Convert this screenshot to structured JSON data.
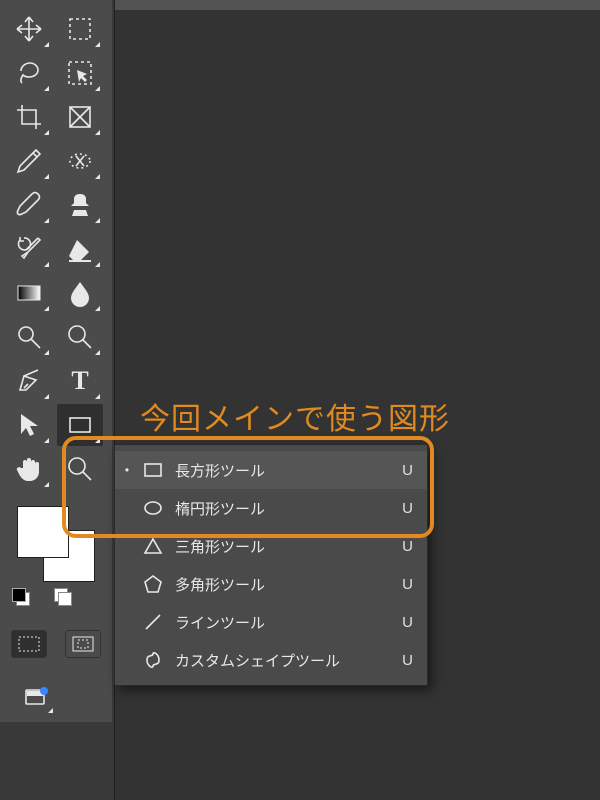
{
  "annotation": {
    "title": "今回メインで使う図形"
  },
  "flyout": {
    "items": [
      {
        "label": "長方形ツール",
        "shortcut": "U",
        "active": true
      },
      {
        "label": "楕円形ツール",
        "shortcut": "U",
        "active": false
      },
      {
        "label": "三角形ツール",
        "shortcut": "U",
        "active": false
      },
      {
        "label": "多角形ツール",
        "shortcut": "U",
        "active": false
      },
      {
        "label": "ラインツール",
        "shortcut": "U",
        "active": false
      },
      {
        "label": "カスタムシェイプツール",
        "shortcut": "U",
        "active": false
      }
    ]
  },
  "tools": {
    "names": [
      "move-tool",
      "marquee-tool",
      "lasso-tool",
      "object-select-tool",
      "crop-tool",
      "frame-tool",
      "eyedropper-tool",
      "healing-brush-tool",
      "brush-tool",
      "clone-stamp-tool",
      "history-brush-tool",
      "eraser-tool",
      "gradient-tool",
      "blur-tool",
      "dodge-tool",
      "zoom-mag-tool",
      "pen-tool",
      "type-tool",
      "path-select-tool",
      "rectangle-shape-tool",
      "hand-tool",
      "zoom-tool"
    ]
  },
  "colors": {
    "annotation": "#e08a1f",
    "panel": "#4b4b4b",
    "canvas": "#333333"
  }
}
